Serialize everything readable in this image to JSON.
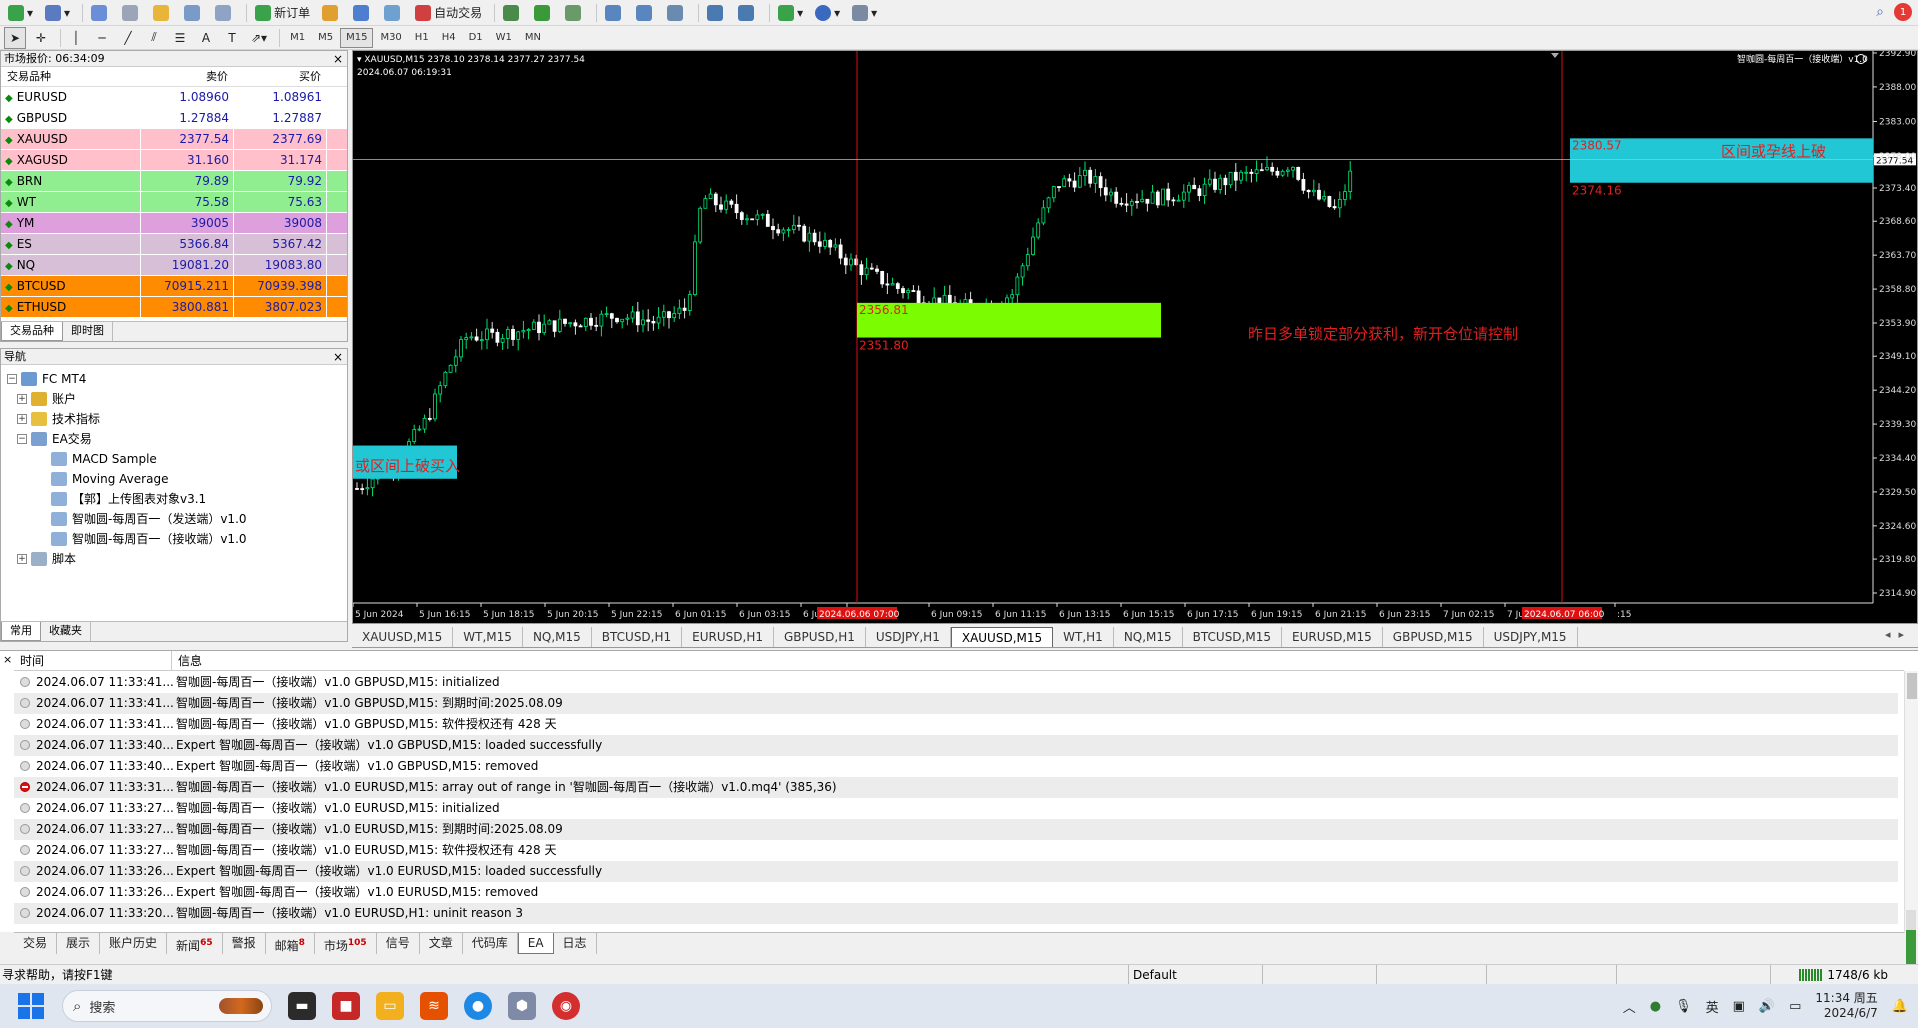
{
  "toolbar": {
    "new_order": "新订单",
    "auto_trade": "自动交易",
    "timeframes": [
      "M1",
      "M5",
      "M15",
      "M30",
      "H1",
      "H4",
      "D1",
      "W1",
      "MN"
    ],
    "active_timeframe": "M15",
    "alert_count": "1"
  },
  "market_watch": {
    "title": "市场报价: 06:34:09",
    "col_symbol": "交易品种",
    "col_bid": "卖价",
    "col_ask": "买价",
    "rows": [
      {
        "symbol": "EURUSD",
        "bid": "1.08960",
        "ask": "1.08961",
        "color": "#ffffff"
      },
      {
        "symbol": "GBPUSD",
        "bid": "1.27884",
        "ask": "1.27887",
        "color": "#ffffff"
      },
      {
        "symbol": "XAUUSD",
        "bid": "2377.54",
        "ask": "2377.69",
        "color": "#ffc0cb"
      },
      {
        "symbol": "XAGUSD",
        "bid": "31.160",
        "ask": "31.174",
        "color": "#ffc0cb"
      },
      {
        "symbol": "BRN",
        "bid": "79.89",
        "ask": "79.92",
        "color": "#90ee90"
      },
      {
        "symbol": "WT",
        "bid": "75.58",
        "ask": "75.63",
        "color": "#90ee90"
      },
      {
        "symbol": "YM",
        "bid": "39005",
        "ask": "39008",
        "color": "#dda0dd"
      },
      {
        "symbol": "ES",
        "bid": "5366.84",
        "ask": "5367.42",
        "color": "#d8bfd8"
      },
      {
        "symbol": "NQ",
        "bid": "19081.20",
        "ask": "19083.80",
        "color": "#d8bfd8"
      },
      {
        "symbol": "BTCUSD",
        "bid": "70915.211",
        "ask": "70939.398",
        "color": "#ff8c00"
      },
      {
        "symbol": "ETHUSD",
        "bid": "3800.881",
        "ask": "3807.023",
        "color": "#ff8c00"
      }
    ],
    "tabs": [
      "交易品种",
      "即时图"
    ]
  },
  "navigator": {
    "title": "导航",
    "root": "FC MT4",
    "account": "账户",
    "indicators": "技术指标",
    "experts": "EA交易",
    "ea_items": [
      "MACD Sample",
      "Moving Average",
      "【郭】上传图表对象v3.1",
      "智咖圆-每周百一（发送端）v1.0",
      "智咖圆-每周百一（接收端）v1.0"
    ],
    "scripts": "脚本",
    "tabs": [
      "常用",
      "收藏夹"
    ]
  },
  "chart": {
    "header": "XAUUSD,M15  2378.10 2378.14 2377.27 2377.54",
    "header_date": "2024.06.07 06:19:31",
    "ea_label": "智咖圆-每周百一（接收端）v1.0",
    "current_price": "2377.54",
    "price_labels": [
      "2392.90",
      "2388.00",
      "2383.00",
      "2378.00",
      "2373.40",
      "2368.60",
      "2363.70",
      "2358.80",
      "2353.90",
      "2349.10",
      "2344.20",
      "2339.30",
      "2334.40",
      "2329.50",
      "2324.60",
      "2319.80",
      "2314.90"
    ],
    "time_labels": [
      "5 Jun 2024",
      "5 Jun 16:15",
      "5 Jun 18:15",
      "5 Jun 20:15",
      "5 Jun 22:15",
      "6 Jun 01:15",
      "6 Jun 03:15",
      "6 Ju",
      "7:15",
      "6 Jun 09:15",
      "6 Jun 11:15",
      "6 Jun 13:15",
      "6 Jun 15:15",
      "6 Jun 17:15",
      "6 Jun 19:15",
      "6 Jun 21:15",
      "6 Jun 23:15",
      "7 Jun 02:15",
      "7 Ju",
      ":15"
    ],
    "zone_green_top": "2356.81",
    "zone_green_bottom": "2351.80",
    "zone_cyan_top": "2380.57",
    "zone_cyan_bottom": "2374.16",
    "note_center": "昨日多单锁定部分获利，新开仓位请控制",
    "note_right": "区间或孕线上破",
    "note_left": "或区间上破买入",
    "vline_tag_1": "2024.06.06 07:00",
    "vline_tag_2": "2024.06.07 06:00"
  },
  "chart_tabs": [
    "XAUUSD,M15",
    "WT,M15",
    "NQ,M15",
    "BTCUSD,H1",
    "EURUSD,H1",
    "GBPUSD,H1",
    "USDJPY,H1",
    "XAUUSD,M15",
    "WT,H1",
    "NQ,M15",
    "BTCUSD,M15",
    "EURUSD,M15",
    "GBPUSD,M15",
    "USDJPY,M15"
  ],
  "active_chart_tab": 7,
  "terminal": {
    "col_time": "时间",
    "col_msg": "信息",
    "logs": [
      {
        "time": "2024.06.07 11:33:41...",
        "msg": "智咖圆-每周百一（接收端）v1.0 GBPUSD,M15: initialized",
        "error": false
      },
      {
        "time": "2024.06.07 11:33:41...",
        "msg": "智咖圆-每周百一（接收端）v1.0 GBPUSD,M15: 到期时间:2025.08.09",
        "error": false
      },
      {
        "time": "2024.06.07 11:33:41...",
        "msg": "智咖圆-每周百一（接收端）v1.0 GBPUSD,M15: 软件授权还有 428 天",
        "error": false
      },
      {
        "time": "2024.06.07 11:33:40...",
        "msg": "Expert 智咖圆-每周百一（接收端）v1.0 GBPUSD,M15: loaded successfully",
        "error": false
      },
      {
        "time": "2024.06.07 11:33:40...",
        "msg": "Expert 智咖圆-每周百一（接收端）v1.0 GBPUSD,M15: removed",
        "error": false
      },
      {
        "time": "2024.06.07 11:33:31...",
        "msg": "智咖圆-每周百一（接收端）v1.0 EURUSD,M15: array out of range in '智咖圆-每周百一（接收端）v1.0.mq4' (385,36)",
        "error": true
      },
      {
        "time": "2024.06.07 11:33:27...",
        "msg": "智咖圆-每周百一（接收端）v1.0 EURUSD,M15: initialized",
        "error": false
      },
      {
        "time": "2024.06.07 11:33:27...",
        "msg": "智咖圆-每周百一（接收端）v1.0 EURUSD,M15: 到期时间:2025.08.09",
        "error": false
      },
      {
        "time": "2024.06.07 11:33:27...",
        "msg": "智咖圆-每周百一（接收端）v1.0 EURUSD,M15: 软件授权还有 428 天",
        "error": false
      },
      {
        "time": "2024.06.07 11:33:26...",
        "msg": "Expert 智咖圆-每周百一（接收端）v1.0 EURUSD,M15: loaded successfully",
        "error": false
      },
      {
        "time": "2024.06.07 11:33:26...",
        "msg": "Expert 智咖圆-每周百一（接收端）v1.0 EURUSD,M15: removed",
        "error": false
      },
      {
        "time": "2024.06.07 11:33:20...",
        "msg": "智咖圆-每周百一（接收端）v1.0 EURUSD,H1: uninit reason 3",
        "error": false
      }
    ],
    "tabs": [
      {
        "label": "交易",
        "badge": ""
      },
      {
        "label": "展示",
        "badge": ""
      },
      {
        "label": "账户历史",
        "badge": ""
      },
      {
        "label": "新闻",
        "badge": "65"
      },
      {
        "label": "警报",
        "badge": ""
      },
      {
        "label": "邮箱",
        "badge": "8"
      },
      {
        "label": "市场",
        "badge": "105"
      },
      {
        "label": "信号",
        "badge": ""
      },
      {
        "label": "文章",
        "badge": ""
      },
      {
        "label": "代码库",
        "badge": ""
      },
      {
        "label": "EA",
        "badge": ""
      },
      {
        "label": "日志",
        "badge": ""
      }
    ],
    "active_tab": 10
  },
  "statusbar": {
    "help": "寻求帮助，请按F1键",
    "profile": "Default",
    "traffic": "1748/6 kb"
  },
  "taskbar": {
    "search": "搜索",
    "ime": "英",
    "time": "11:34 周五",
    "date": "2024/6/7"
  }
}
